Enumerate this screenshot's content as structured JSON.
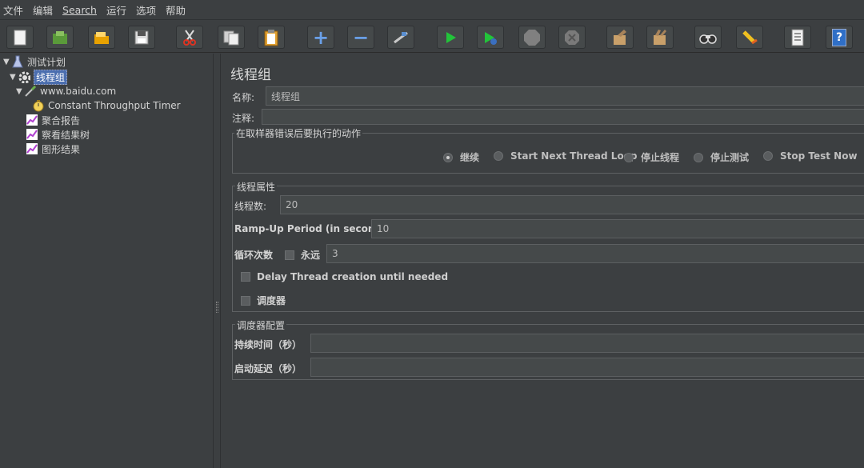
{
  "menu": [
    "文件",
    "编辑",
    "Search",
    "运行",
    "选项",
    "帮助"
  ],
  "toolbar": [
    {
      "name": "new-icon",
      "glyph": ""
    },
    {
      "name": "templates-icon",
      "glyph": ""
    },
    {
      "name": "open-icon",
      "glyph": ""
    },
    {
      "name": "save-icon",
      "glyph": ""
    },
    {
      "name": "cut-icon",
      "glyph": ""
    },
    {
      "name": "copy-icon",
      "glyph": ""
    },
    {
      "name": "paste-icon",
      "glyph": ""
    },
    {
      "name": "expand-icon",
      "glyph": "+"
    },
    {
      "name": "collapse-icon",
      "glyph": "−"
    },
    {
      "name": "toggle-icon",
      "glyph": ""
    },
    {
      "name": "start-icon",
      "glyph": ""
    },
    {
      "name": "start-no-pauses-icon",
      "glyph": ""
    },
    {
      "name": "stop-icon",
      "glyph": ""
    },
    {
      "name": "shutdown-icon",
      "glyph": ""
    },
    {
      "name": "clear-icon",
      "glyph": ""
    },
    {
      "name": "clear-all-icon",
      "glyph": ""
    },
    {
      "name": "search-icon",
      "glyph": ""
    },
    {
      "name": "reset-search-icon",
      "glyph": ""
    },
    {
      "name": "function-helper-icon",
      "glyph": ""
    },
    {
      "name": "help-icon",
      "glyph": "?"
    }
  ],
  "tree": {
    "test_plan": "测试计划",
    "thread_group": "线程组",
    "sampler": "www.baidu.com",
    "timer": "Constant Throughput Timer",
    "listener_aggregate": "聚合报告",
    "listener_results_tree": "察看结果树",
    "listener_graph": "图形结果"
  },
  "panel": {
    "title": "线程组",
    "name_label": "名称:",
    "name_value": "线程组",
    "comment_label": "注释:",
    "comment_value": "",
    "error_action_legend": "在取样器错误后要执行的动作",
    "error_actions": [
      {
        "label": "继续",
        "selected": true
      },
      {
        "label": "Start Next Thread Loop",
        "selected": false
      },
      {
        "label": "停止线程",
        "selected": false
      },
      {
        "label": "停止测试",
        "selected": false
      },
      {
        "label": "Stop Test Now",
        "selected": false
      }
    ],
    "thread_props_legend": "线程属性",
    "threads_label": "线程数:",
    "threads_value": "20",
    "rampup_label": "Ramp-Up Period (in seconds):",
    "rampup_value": "10",
    "loop_label": "循环次数",
    "forever_label": "永远",
    "loop_value": "3",
    "delay_label": "Delay Thread creation until needed",
    "scheduler_label": "调度器",
    "scheduler_config_legend": "调度器配置",
    "duration_label": "持续时间（秒）",
    "duration_value": "",
    "startup_delay_label": "启动延迟（秒）",
    "startup_delay_value": ""
  },
  "colors": {
    "background": "#3c3f41",
    "selection": "#4b6eaf",
    "field": "#45494a"
  }
}
